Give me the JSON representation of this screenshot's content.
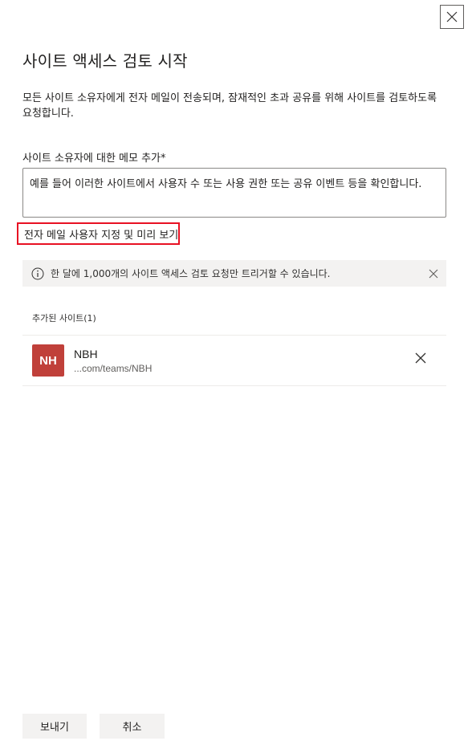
{
  "panel": {
    "title": "사이트 액세스 검토 시작",
    "description": "모든 사이트 소유자에게 전자 메일이 전송되며, 잠재적인 초과 공유를 위해 사이트를 검토하도록 요청합니다."
  },
  "note_field": {
    "label": "사이트 소유자에 대한 메모 추가",
    "required_marker": "*",
    "value": "예를 들어 이러한 사이트에서 사용자 수 또는 사용 권한 또는 공유 이벤트 등을 확인합니다."
  },
  "preview_link": {
    "label": "전자 메일 사용자 지정 및 미리 보기"
  },
  "info_bar": {
    "icon": "info-icon",
    "message": "한 달에 1,000개의 사이트 액세스 검토 요청만 트리거할 수 있습니다."
  },
  "sites": {
    "header": "추가된 사이트",
    "count": "(1)",
    "items": [
      {
        "initials": "NH",
        "name": "NBH",
        "url": "...com/teams/NBH",
        "avatar_color": "#c0403a"
      }
    ]
  },
  "footer": {
    "send_label": "보내기",
    "cancel_label": "취소"
  },
  "colors": {
    "highlight_border": "#e81123",
    "info_bar_bg": "#f3f2f1"
  }
}
